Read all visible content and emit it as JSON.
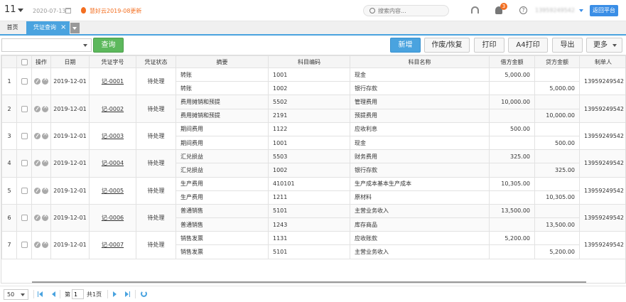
{
  "header": {
    "period": "11",
    "date": "2020-07-13",
    "notice": "慧好云2019-08更新",
    "search_placeholder": "搜索内容...",
    "notification_count": "3",
    "help": "?",
    "username": "13959249542",
    "return_label": "返回平台"
  },
  "tabs": {
    "home": "首页",
    "active": "凭证查询",
    "close": "×"
  },
  "toolbar": {
    "query_label": "查询",
    "buttons": [
      "新增",
      "作废/恢复",
      "打印",
      "A4打印",
      "导出",
      "更多"
    ]
  },
  "table": {
    "columns": [
      "",
      "",
      "操作",
      "日期",
      "凭证字号",
      "凭证状态",
      "摘要",
      "科目编码",
      "科目名称",
      "借方金额",
      "贷方金额",
      "制单人"
    ],
    "vouchers": [
      {
        "no": "1",
        "date": "2019-12-01",
        "voucher": "记-0001",
        "status": "待处理",
        "maker": "13959249542",
        "lines": [
          {
            "summary": "转账",
            "code": "1001",
            "name": "现金",
            "debit": "5,000.00",
            "credit": ""
          },
          {
            "summary": "转账",
            "code": "1002",
            "name": "银行存款",
            "debit": "",
            "credit": "5,000.00"
          }
        ]
      },
      {
        "no": "2",
        "date": "2019-12-01",
        "voucher": "记-0002",
        "status": "待处理",
        "maker": "13959249542",
        "lines": [
          {
            "summary": "费用摊销和预提",
            "code": "5502",
            "name": "管理费用",
            "debit": "10,000.00",
            "credit": ""
          },
          {
            "summary": "费用摊销和预提",
            "code": "2191",
            "name": "预提费用",
            "debit": "",
            "credit": "10,000.00"
          }
        ]
      },
      {
        "no": "3",
        "date": "2019-12-01",
        "voucher": "记-0003",
        "status": "待处理",
        "maker": "13959249542",
        "lines": [
          {
            "summary": "期间费用",
            "code": "1122",
            "name": "应收利息",
            "debit": "500.00",
            "credit": ""
          },
          {
            "summary": "期间费用",
            "code": "1001",
            "name": "现金",
            "debit": "",
            "credit": "500.00"
          }
        ]
      },
      {
        "no": "4",
        "date": "2019-12-01",
        "voucher": "记-0004",
        "status": "待处理",
        "maker": "13959249542",
        "lines": [
          {
            "summary": "汇兑损益",
            "code": "5503",
            "name": "财务费用",
            "debit": "325.00",
            "credit": ""
          },
          {
            "summary": "汇兑损益",
            "code": "1002",
            "name": "银行存款",
            "debit": "",
            "credit": "325.00"
          }
        ]
      },
      {
        "no": "5",
        "date": "2019-12-01",
        "voucher": "记-0005",
        "status": "待处理",
        "maker": "13959249542",
        "lines": [
          {
            "summary": "生产费用",
            "code": "410101",
            "name": "生产成本基本生产成本",
            "debit": "10,305.00",
            "credit": ""
          },
          {
            "summary": "生产费用",
            "code": "1211",
            "name": "原材料",
            "debit": "",
            "credit": "10,305.00"
          }
        ]
      },
      {
        "no": "6",
        "date": "2019-12-01",
        "voucher": "记-0006",
        "status": "待处理",
        "maker": "13959249542",
        "lines": [
          {
            "summary": "普通销售",
            "code": "5101",
            "name": "主营业务收入",
            "debit": "13,500.00",
            "credit": ""
          },
          {
            "summary": "普通销售",
            "code": "1243",
            "name": "库存商品",
            "debit": "",
            "credit": "13,500.00"
          }
        ]
      },
      {
        "no": "7",
        "date": "2019-12-01",
        "voucher": "记-0007",
        "status": "待处理",
        "maker": "13959249542",
        "lines": [
          {
            "summary": "销售发票",
            "code": "1131",
            "name": "应收账款",
            "debit": "5,200.00",
            "credit": ""
          },
          {
            "summary": "销售发票",
            "code": "5101",
            "name": "主营业务收入",
            "debit": "",
            "credit": "5,200.00"
          }
        ]
      }
    ]
  },
  "pager": {
    "page_size": "50",
    "page_prefix": "第",
    "page_value": "1",
    "total_pages": "共1页"
  },
  "colors": {
    "accent": "#4aa3df",
    "query_green": "#5cb85c",
    "notice_orange": "#f36f21"
  },
  "icons": [
    "calendar-icon",
    "fire-icon",
    "search-icon",
    "headset-icon",
    "bell-icon",
    "help-icon",
    "close-icon",
    "edit-icon",
    "delete-icon",
    "first-page-icon",
    "prev-page-icon",
    "next-page-icon",
    "last-page-icon",
    "refresh-icon"
  ]
}
